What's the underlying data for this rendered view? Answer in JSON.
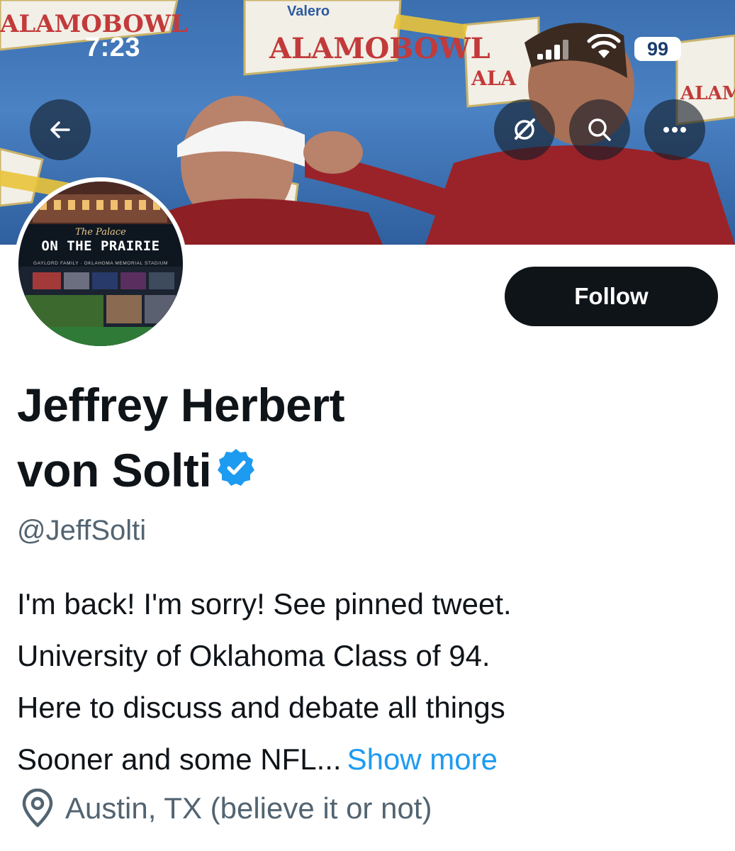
{
  "status_bar": {
    "time": "7:23",
    "battery": "99"
  },
  "banner": {
    "sponsor_text": "Valero",
    "event_text": "ALAMOBOWL"
  },
  "header_actions": {
    "back_icon": "arrow-left-icon",
    "grok_icon": "grok-icon",
    "search_icon": "search-icon",
    "more_icon": "more-horizontal-icon"
  },
  "avatar": {
    "small_title": "The Palace",
    "title": "ON THE PRAIRIE",
    "subtitle": "GAYLORD FAMILY · OKLAHOMA MEMORIAL STADIUM"
  },
  "follow_button": {
    "label": "Follow"
  },
  "profile": {
    "name_line1": "Jeffrey Herbert",
    "name_line2": "von Solti",
    "handle": "@JeffSolti",
    "bio_lines": [
      "I'm back! I'm sorry! See pinned tweet.",
      "University of Oklahoma Class of 94.",
      "Here to discuss and debate all things",
      "Sooner and some NFL..."
    ],
    "show_more": "Show more",
    "location": "Austin, TX (believe it or not)"
  },
  "colors": {
    "accent": "#1d9bf0",
    "text": "#0f1419",
    "secondary_text": "#536471",
    "follow_bg": "#0f1419"
  }
}
